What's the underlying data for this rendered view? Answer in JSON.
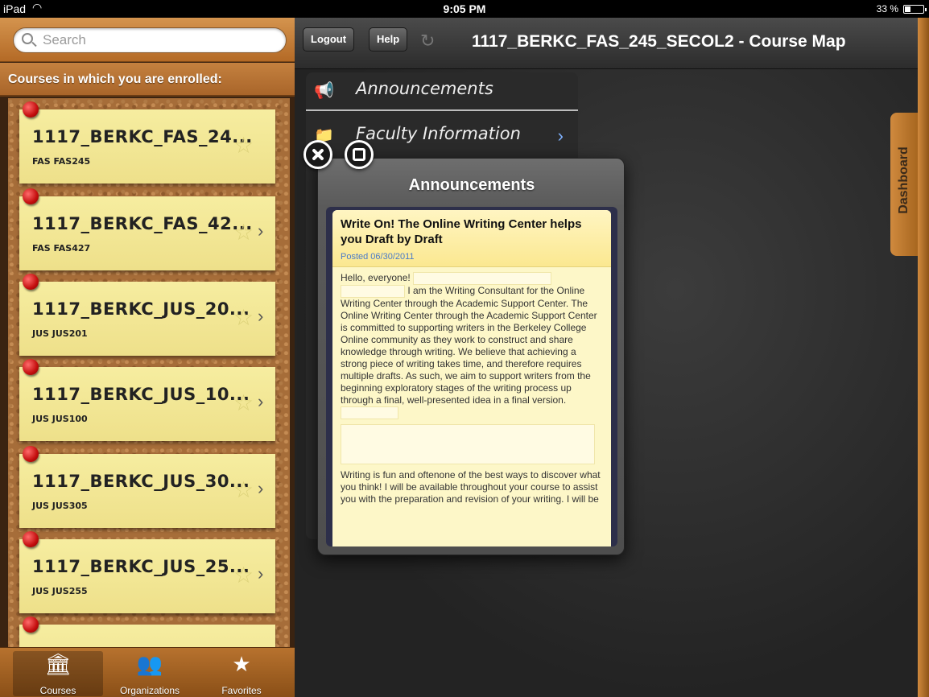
{
  "status_bar": {
    "carrier": "iPad",
    "time": "9:05 PM",
    "battery": "33 %"
  },
  "search": {
    "placeholder": "Search"
  },
  "sidebar": {
    "section_title": "Courses in which you are enrolled:",
    "courses": [
      {
        "title": "1117_BERKC_FAS_24...",
        "code": "FAS FAS245"
      },
      {
        "title": "1117_BERKC_FAS_42...",
        "code": "FAS FAS427"
      },
      {
        "title": "1117_BERKC_JUS_20...",
        "code": "JUS JUS201"
      },
      {
        "title": "1117_BERKC_JUS_10...",
        "code": "JUS JUS100"
      },
      {
        "title": "1117_BERKC_JUS_30...",
        "code": "JUS JUS305"
      },
      {
        "title": "1117_BERKC_JUS_25...",
        "code": "JUS JUS255"
      }
    ],
    "tabs": [
      {
        "label": "Courses",
        "icon": "columns-icon"
      },
      {
        "label": "Organizations",
        "icon": "people-icon"
      },
      {
        "label": "Favorites",
        "icon": "star-icon"
      }
    ]
  },
  "toolbar": {
    "logout": "Logout",
    "help": "Help",
    "title": "1117_BERKC_FAS_245_SECOL2 - Course Map"
  },
  "menu": {
    "items": [
      {
        "label": "Announcements",
        "icon": "megaphone-icon"
      },
      {
        "label": "Faculty Information",
        "icon": "folder-icon"
      }
    ]
  },
  "dashboard": {
    "label": "Dashboard"
  },
  "popover": {
    "title": "Announcements",
    "post": {
      "heading": "Write On! The Online Writing Center helps you Draft by Draft",
      "date": "Posted 06/30/2011",
      "greeting": "Hello, everyone!",
      "p1": "I am the Writing Consultant for the Online Writing Center through the Academic Support Center.  The Online Writing Center through the Academic Support Center is committed to supporting writers in the Berkeley College Online community as they work to construct and share knowledge through writing. We believe that achieving a strong piece of writing takes time, and therefore requires multiple drafts. As such, we aim to support writers from the beginning exploratory stages of the writing process up through a final, well-presented idea in a final version.",
      "p2": "Writing is fun and oftenone of the best ways to discover what you think! I will be available throughout your course to assist you with the preparation and revision of your writing.  I will be"
    }
  }
}
